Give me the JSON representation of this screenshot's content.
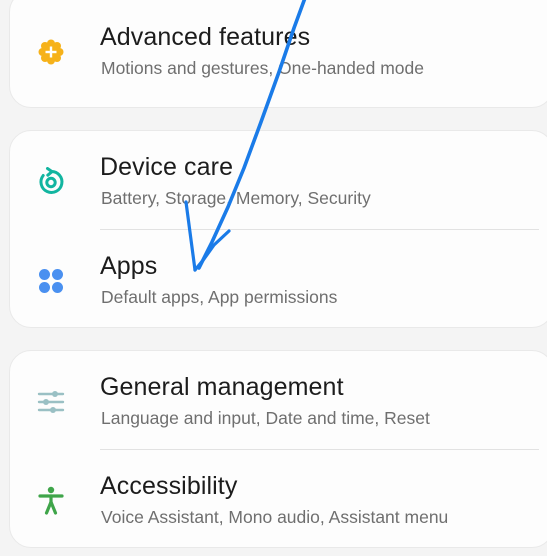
{
  "settings": {
    "items": [
      {
        "title": "Advanced features",
        "subtitle": "Motions and gestures, One-handed mode",
        "icon": "advanced-features-icon",
        "color": "#f6b21a"
      },
      {
        "title": "Device care",
        "subtitle": "Battery, Storage, Memory, Security",
        "icon": "device-care-icon",
        "color": "#12b5a0"
      },
      {
        "title": "Apps",
        "subtitle": "Default apps, App permissions",
        "icon": "apps-icon",
        "color": "#4a90f0"
      },
      {
        "title": "General management",
        "subtitle": "Language and input, Date and time, Reset",
        "icon": "general-management-icon",
        "color": "#9ac0c4"
      },
      {
        "title": "Accessibility",
        "subtitle": "Voice Assistant, Mono audio, Assistant menu",
        "icon": "accessibility-icon",
        "color": "#3fa54a"
      }
    ]
  },
  "annotation": {
    "color": "#1a7be8",
    "icon": "annotation-arrow"
  }
}
